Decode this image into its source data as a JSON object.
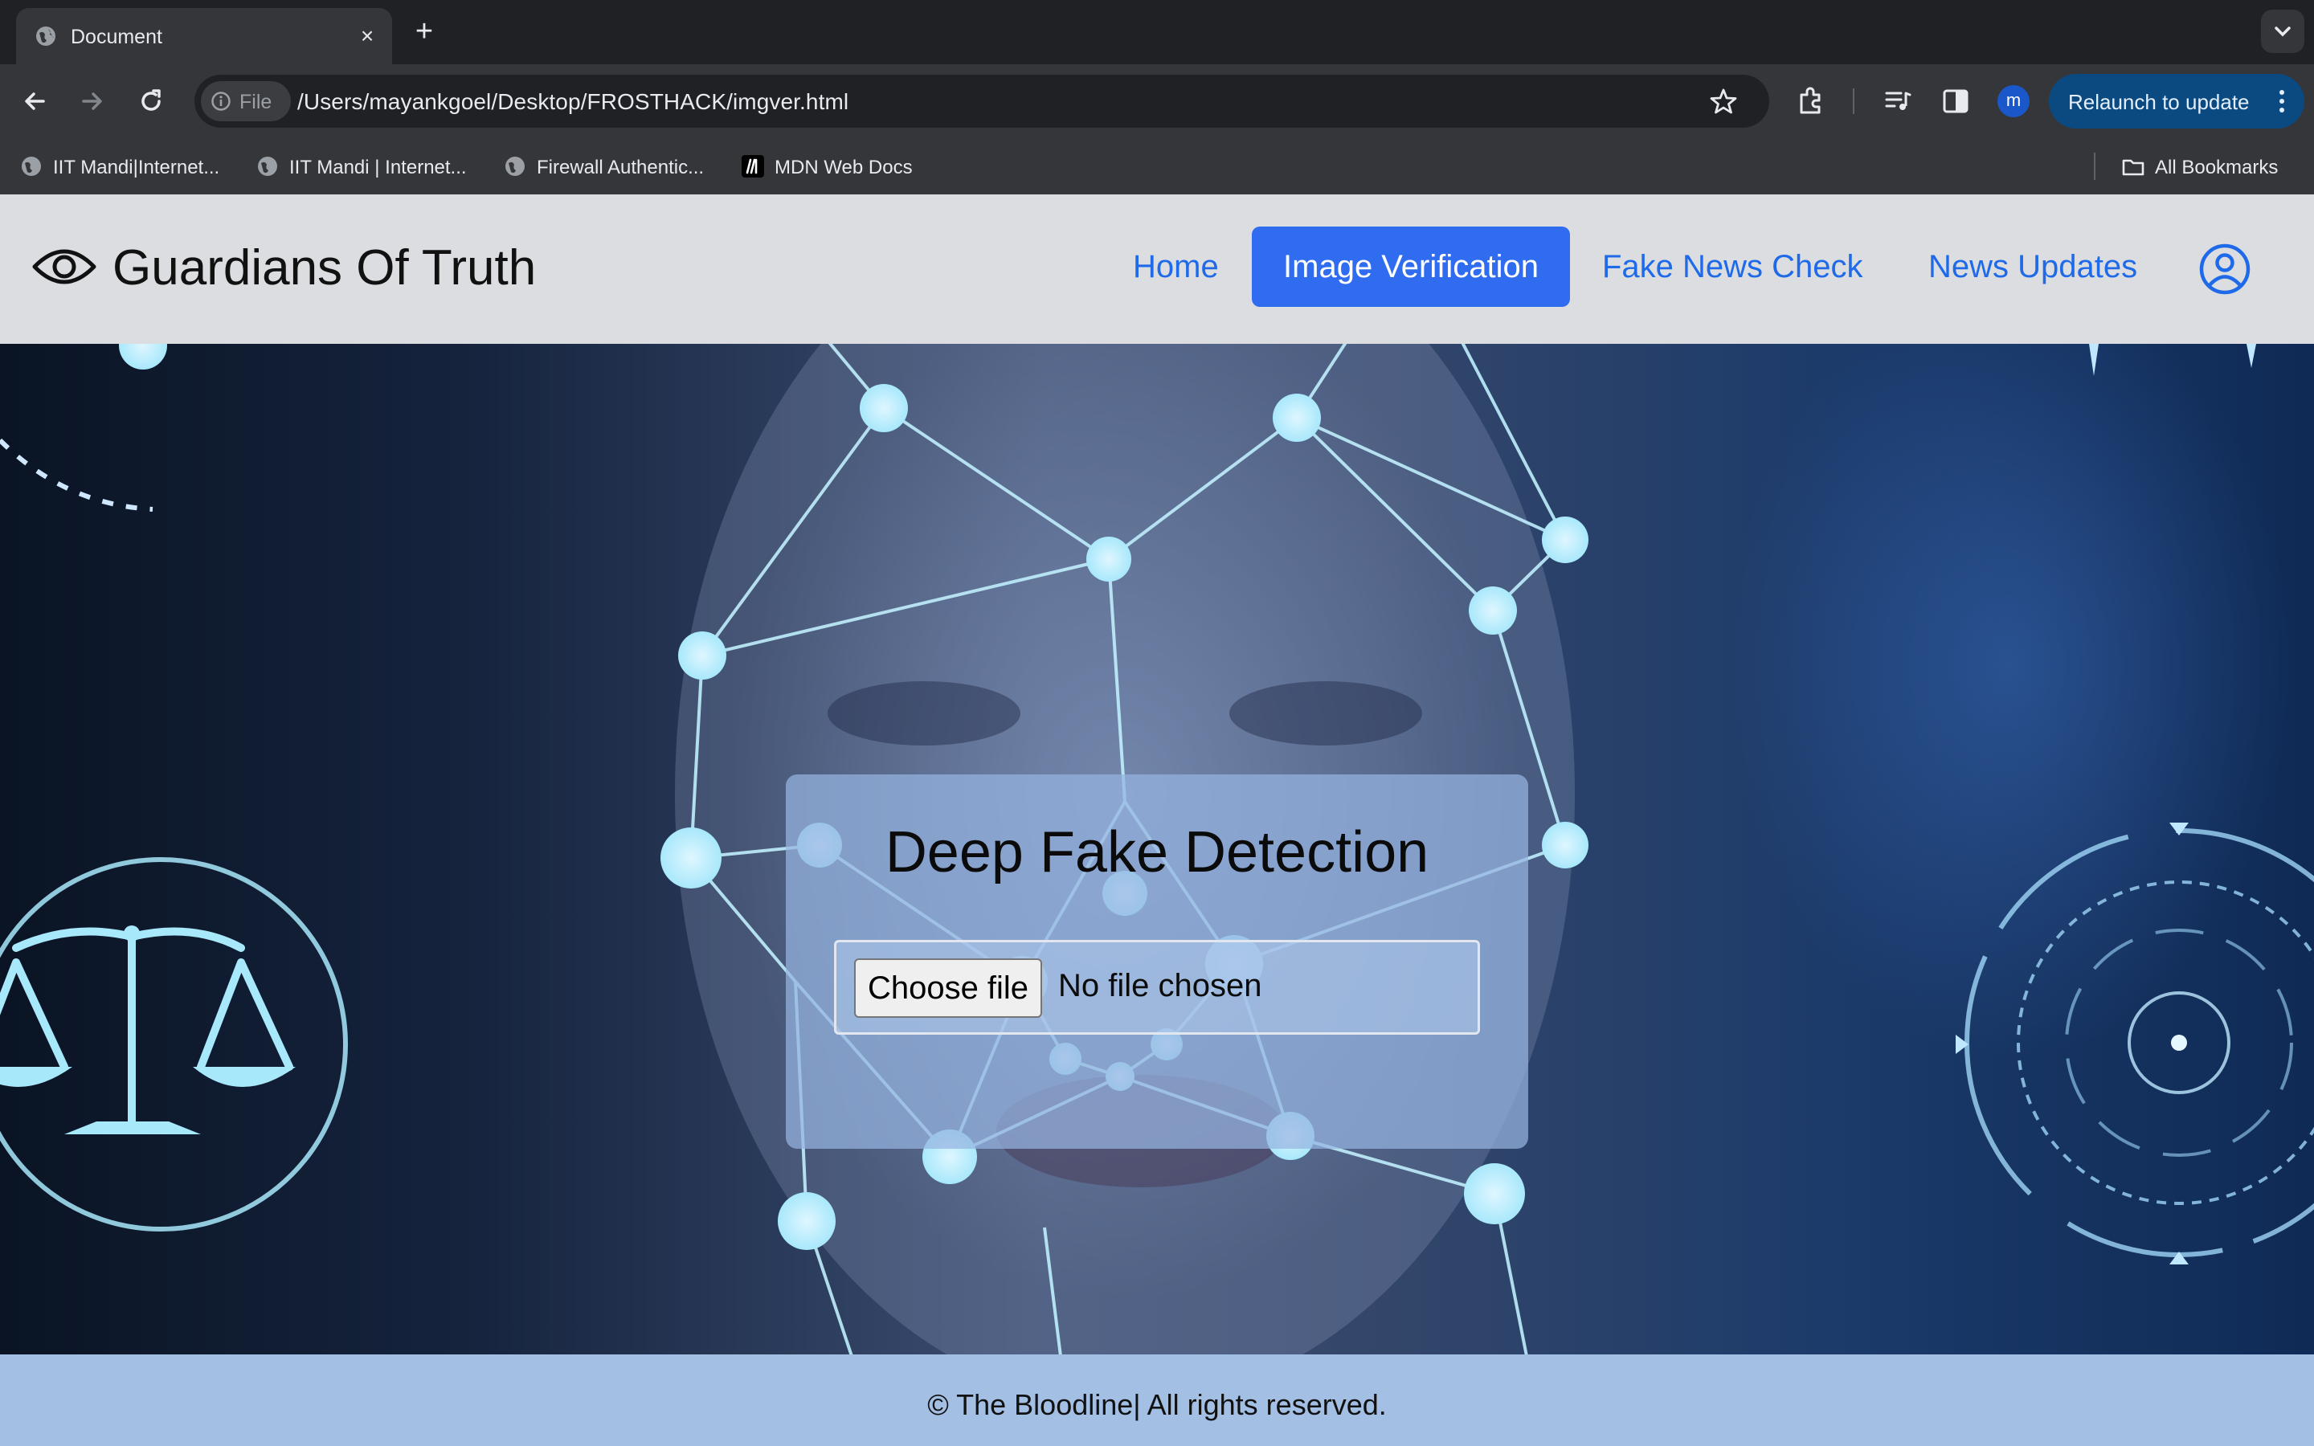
{
  "browser": {
    "tab": {
      "title": "Document",
      "favicon": "globe-icon",
      "close": "×"
    },
    "new_tab": "+",
    "address": {
      "scheme_label": "File",
      "url": "/Users/mayankgoel/Desktop/FROSTHACK/imgver.html"
    },
    "profile_initial": "m",
    "relaunch_label": "Relaunch to update",
    "bookmarks": [
      {
        "label": "IIT Mandi|Internet...",
        "icon": "globe-icon"
      },
      {
        "label": "IIT Mandi | Internet...",
        "icon": "globe-icon"
      },
      {
        "label": "Firewall Authentic...",
        "icon": "globe-icon"
      },
      {
        "label": "MDN Web Docs",
        "icon": "mdn-icon"
      }
    ],
    "all_bookmarks": "All Bookmarks"
  },
  "site": {
    "brand": "Guardians Of Truth",
    "nav": {
      "home": "Home",
      "image_verification": "Image Verification",
      "fake_news_check": "Fake News Check",
      "news_updates": "News Updates"
    },
    "active_nav": "Image Verification",
    "accent": "#2f6cf0",
    "link_color": "#1f6ae8"
  },
  "detector": {
    "title": "Deep Fake Detection",
    "choose_file": "Choose file",
    "file_status": "No file chosen"
  },
  "footer": {
    "text": "© The Bloodline| All rights reserved."
  }
}
